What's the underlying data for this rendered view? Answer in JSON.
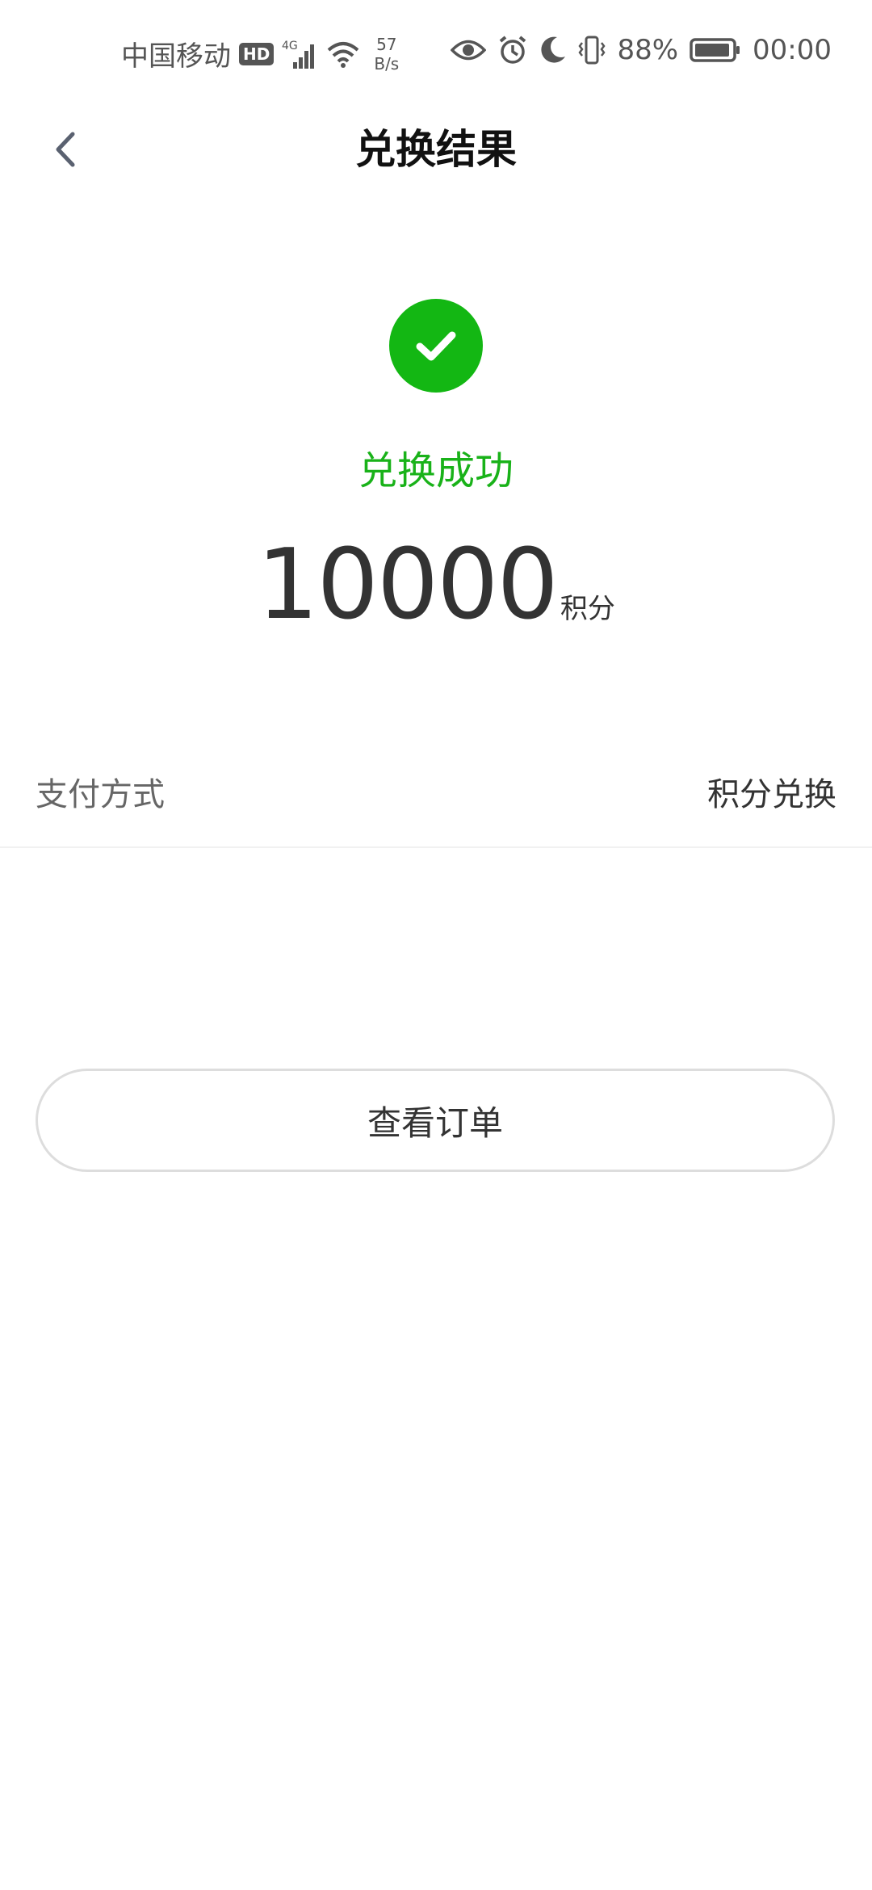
{
  "status_bar": {
    "carrier": "中国移动",
    "hd": "HD",
    "network": "4G",
    "speed_value": "57",
    "speed_unit": "B/s",
    "battery_percent": "88%",
    "time": "00:00"
  },
  "header": {
    "title": "兑换结果"
  },
  "result": {
    "status_text": "兑换成功",
    "amount": "10000",
    "amount_unit": "积分"
  },
  "payment": {
    "label": "支付方式",
    "value": "积分兑换"
  },
  "actions": {
    "view_order_label": "查看订单"
  },
  "colors": {
    "success": "#13b713",
    "text_primary": "#333333",
    "text_secondary": "#666666"
  }
}
